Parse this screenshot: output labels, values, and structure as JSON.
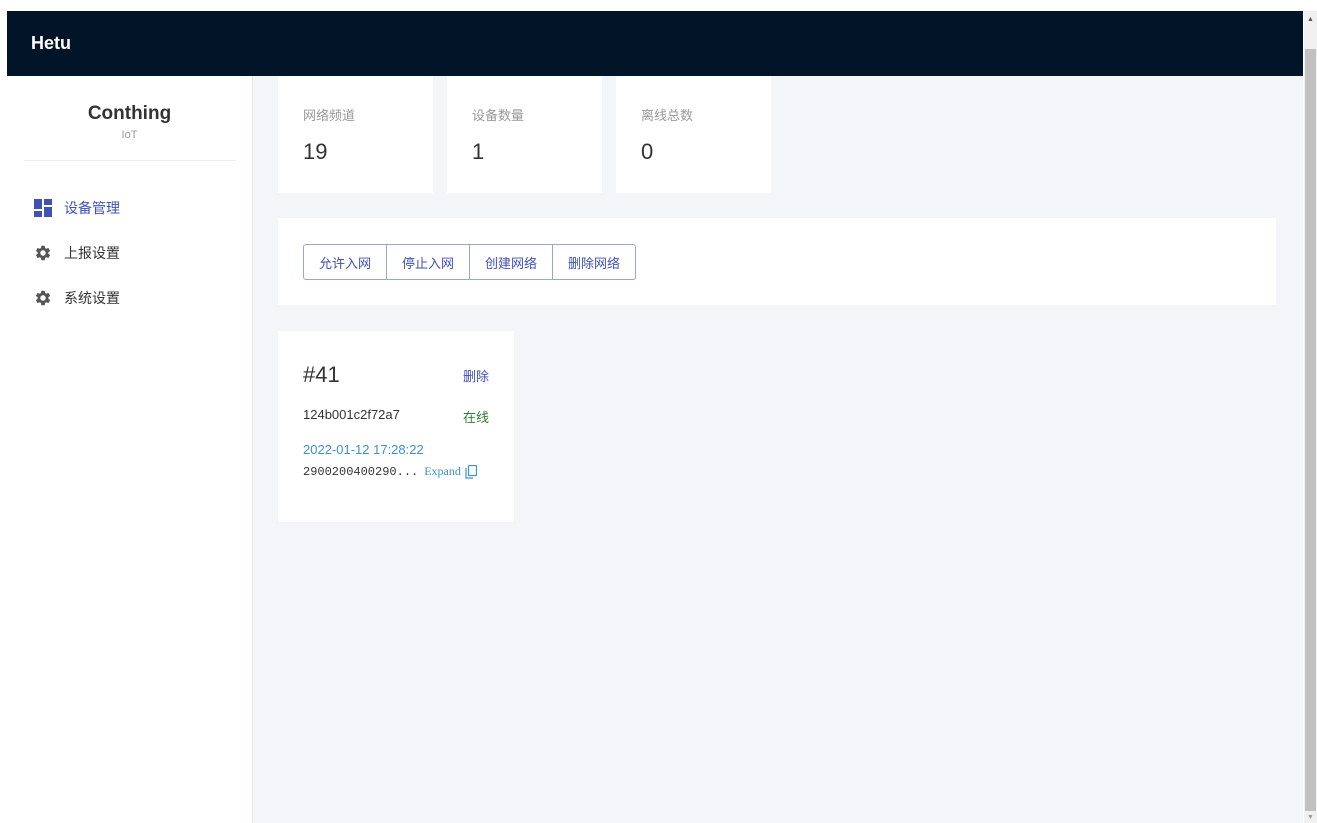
{
  "header": {
    "brand": "Hetu"
  },
  "sidebar": {
    "logo_name": "Conthing",
    "logo_sub": "IoT",
    "items": [
      {
        "label": "设备管理",
        "icon": "dashboard-icon",
        "active": true
      },
      {
        "label": "上报设置",
        "icon": "gear-icon",
        "active": false
      },
      {
        "label": "系统设置",
        "icon": "gear-icon",
        "active": false
      }
    ]
  },
  "stats": [
    {
      "label": "网络频道",
      "value": "19"
    },
    {
      "label": "设备数量",
      "value": "1"
    },
    {
      "label": "离线总数",
      "value": "0"
    }
  ],
  "toolbar": {
    "buttons": [
      {
        "label": "允许入网"
      },
      {
        "label": "停止入网"
      },
      {
        "label": "创建网络"
      },
      {
        "label": "删除网络"
      }
    ]
  },
  "device": {
    "id": "#41",
    "delete_label": "删除",
    "mac": "124b001c2f72a7",
    "status": "在线",
    "time": "2022-01-12 17:28:22",
    "payload": "2900200400290...",
    "expand_label": "Expand"
  },
  "colors": {
    "header_bg": "#011428",
    "accent": "#3f51b5",
    "online": "#2e7d32",
    "timestamp": "#3d8fd8",
    "content_bg": "#f3f5f9"
  }
}
